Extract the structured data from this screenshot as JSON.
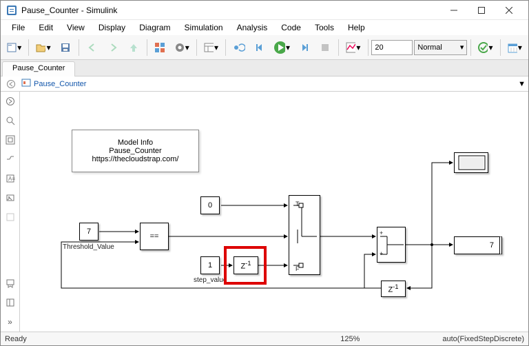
{
  "window": {
    "title": "Pause_Counter - Simulink"
  },
  "menu": {
    "file": "File",
    "edit": "Edit",
    "view": "View",
    "display": "Display",
    "diagram": "Diagram",
    "simulation": "Simulation",
    "analysis": "Analysis",
    "code": "Code",
    "tools": "Tools",
    "help": "Help"
  },
  "toolbar": {
    "stop_time": "20",
    "mode": "Normal"
  },
  "tab": {
    "name": "Pause_Counter"
  },
  "crumb": {
    "model": "Pause_Counter"
  },
  "canvas": {
    "note_line1": "Model Info",
    "note_line2": "Pause_Counter",
    "note_line3": "https://thecloudstrap.com/",
    "threshold": {
      "value": "7",
      "label": "Threshold_Value"
    },
    "compare_op": "==",
    "const_zero": "0",
    "step": {
      "value": "1",
      "label": "step_value"
    },
    "delay_sym": "Z",
    "switch": {
      "t": "T",
      "f": "F"
    },
    "sum_plus": "+",
    "display_value": "7"
  },
  "status": {
    "ready": "Ready",
    "zoom": "125%",
    "solver": "auto(FixedStepDiscrete)"
  }
}
